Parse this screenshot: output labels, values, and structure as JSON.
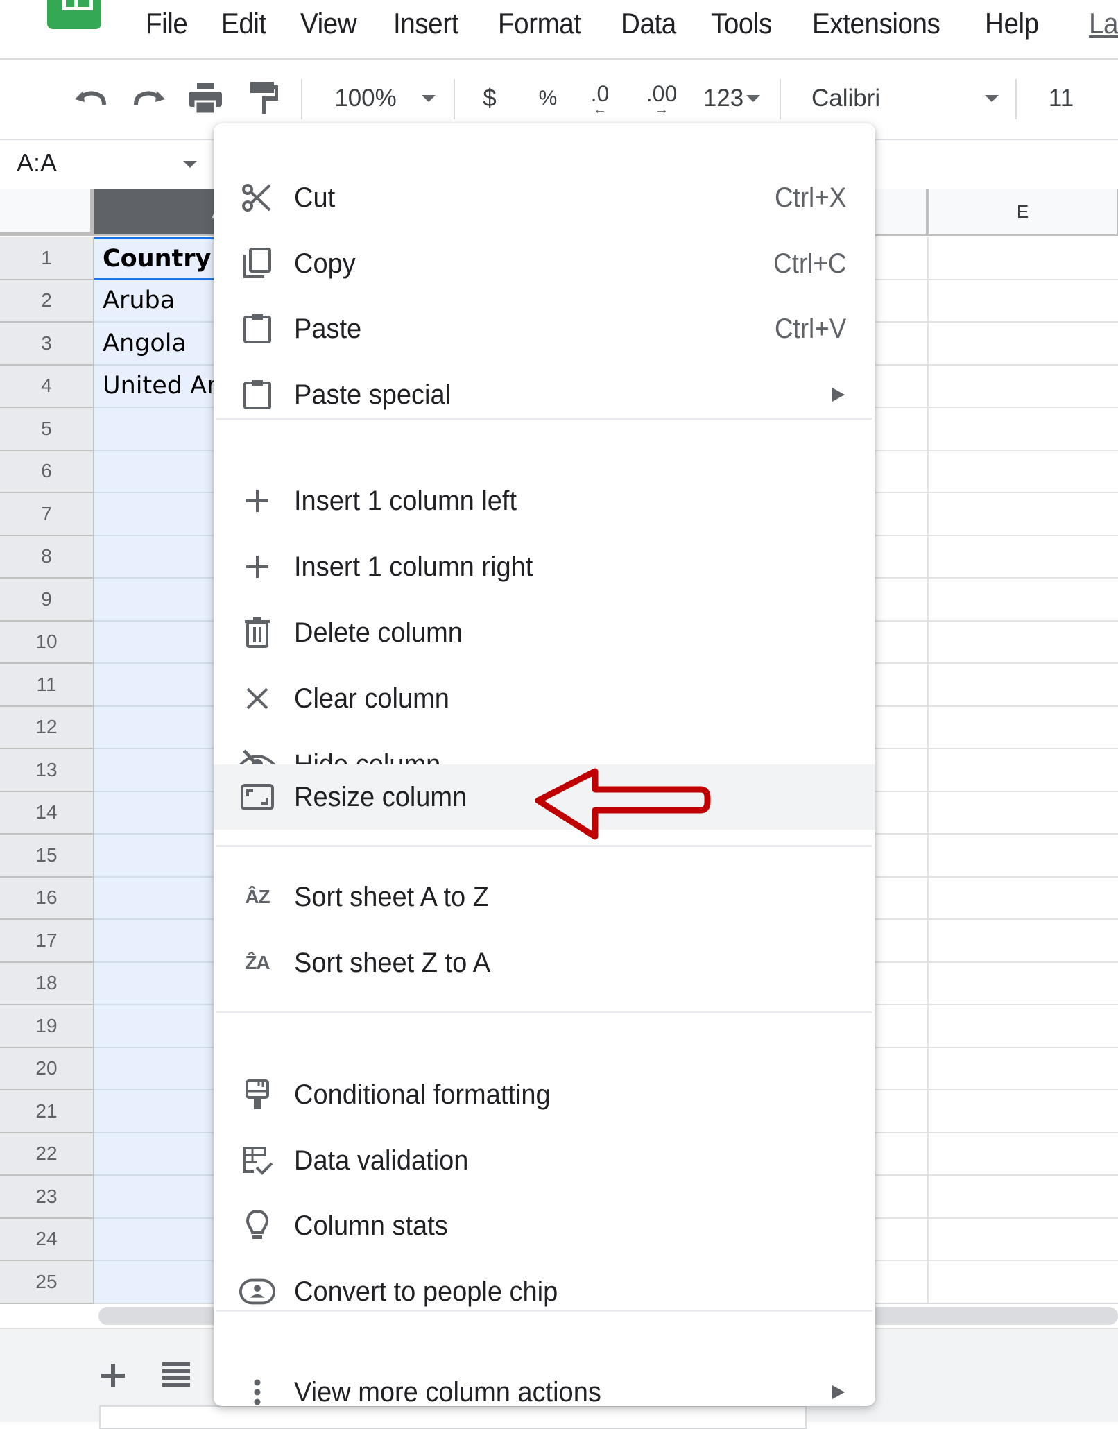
{
  "menubar": {
    "items": [
      "File",
      "Edit",
      "View",
      "Insert",
      "Format",
      "Data",
      "Tools",
      "Extensions",
      "Help",
      "La"
    ]
  },
  "toolbar": {
    "undo_icon": "undo-icon",
    "redo_icon": "redo-icon",
    "print_icon": "print-icon",
    "paint_format_icon": "paint-format-icon",
    "zoom": "100%",
    "currency": "$",
    "percent": "%",
    "decrease_decimal": ".0",
    "increase_decimal": ".00",
    "number_format": "123",
    "font": "Calibri",
    "font_size": "11"
  },
  "formula_bar": {
    "name_box": "A:A"
  },
  "grid": {
    "columns": [
      {
        "label": "A",
        "selected": true
      },
      {
        "label": "E",
        "selected": false
      }
    ],
    "rows": [
      {
        "num": "1",
        "a": "Country"
      },
      {
        "num": "2",
        "a": "Aruba"
      },
      {
        "num": "3",
        "a": "Angola"
      },
      {
        "num": "4",
        "a": "United Ar"
      },
      {
        "num": "5",
        "a": ""
      },
      {
        "num": "6",
        "a": ""
      },
      {
        "num": "7",
        "a": ""
      },
      {
        "num": "8",
        "a": ""
      },
      {
        "num": "9",
        "a": ""
      },
      {
        "num": "10",
        "a": ""
      },
      {
        "num": "11",
        "a": ""
      },
      {
        "num": "12",
        "a": ""
      },
      {
        "num": "13",
        "a": ""
      },
      {
        "num": "14",
        "a": ""
      },
      {
        "num": "15",
        "a": ""
      },
      {
        "num": "16",
        "a": ""
      },
      {
        "num": "17",
        "a": ""
      },
      {
        "num": "18",
        "a": ""
      },
      {
        "num": "19",
        "a": ""
      },
      {
        "num": "20",
        "a": ""
      },
      {
        "num": "21",
        "a": ""
      },
      {
        "num": "22",
        "a": ""
      },
      {
        "num": "23",
        "a": ""
      },
      {
        "num": "24",
        "a": ""
      },
      {
        "num": "25",
        "a": ""
      }
    ]
  },
  "bottom_bar": {
    "add_sheet_icon": "plus-icon",
    "all_sheets_icon": "list-icon"
  },
  "context_menu": {
    "items": [
      {
        "label": "Cut",
        "shortcut": "Ctrl+X",
        "icon": "scissors-icon"
      },
      {
        "label": "Copy",
        "shortcut": "Ctrl+C",
        "icon": "copy-icon"
      },
      {
        "label": "Paste",
        "shortcut": "Ctrl+V",
        "icon": "clipboard-icon"
      },
      {
        "label": "Paste special",
        "submenu": true,
        "icon": "clipboard-icon"
      },
      {
        "label": "Insert 1 column left",
        "icon": "plus-icon"
      },
      {
        "label": "Insert 1 column right",
        "icon": "plus-icon"
      },
      {
        "label": "Delete column",
        "icon": "trash-icon"
      },
      {
        "label": "Clear column",
        "icon": "close-icon"
      },
      {
        "label": "Hide column",
        "icon": "eye-off-icon"
      },
      {
        "label": "Resize column",
        "icon": "resize-icon",
        "highlighted": true
      },
      {
        "label": "Sort sheet A to Z",
        "icon": "sort-az-icon"
      },
      {
        "label": "Sort sheet Z to A",
        "icon": "sort-za-icon"
      },
      {
        "label": "Conditional formatting",
        "icon": "paint-roller-icon"
      },
      {
        "label": "Data validation",
        "icon": "data-validation-icon"
      },
      {
        "label": "Column stats",
        "icon": "lightbulb-icon"
      },
      {
        "label": "Convert to people chip",
        "icon": "people-chip-icon"
      },
      {
        "label": "View more column actions",
        "submenu": true,
        "icon": "more-vert-icon"
      }
    ]
  },
  "annotation": {
    "arrow_color": "#c00000",
    "points_to": "Resize column"
  },
  "colors": {
    "selection_fill": "#e8f0fe",
    "selection_border": "#1a73e8",
    "selected_header": "#5f6368",
    "logo_green": "#34a853"
  }
}
